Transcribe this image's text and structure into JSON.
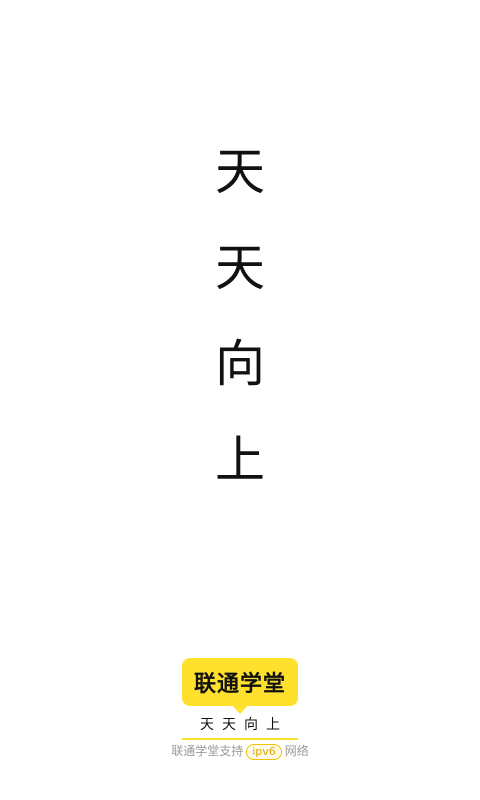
{
  "slogan": [
    "天",
    "天",
    "向",
    "上"
  ],
  "brand": {
    "name": "联通学堂",
    "tagline": "天天向上",
    "accent_color": "#ffe02d"
  },
  "footer": {
    "prefix": "联通学堂支持",
    "badge": "ipv6",
    "suffix": "网络"
  }
}
